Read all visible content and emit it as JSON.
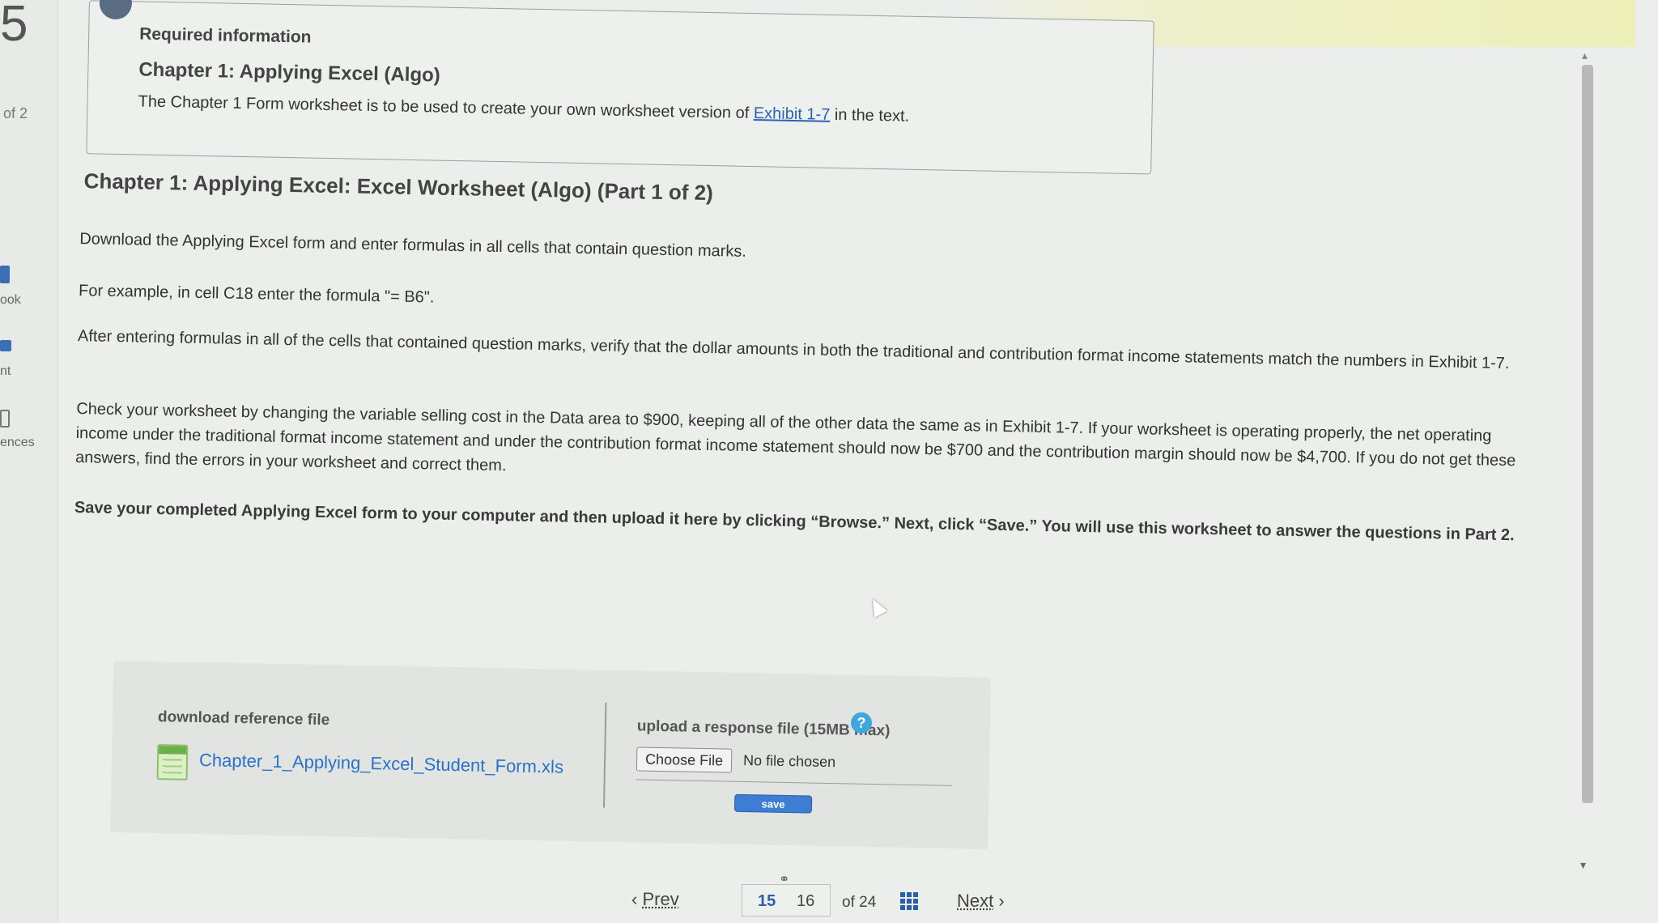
{
  "rail": {
    "question_number": "5",
    "part_of": "of 2",
    "labels": [
      "ook",
      "nt",
      "ences"
    ]
  },
  "info": {
    "header": "Required information",
    "title": "Chapter 1: Applying Excel (Algo)",
    "text_before": "The Chapter 1 Form worksheet is to be used to create your own worksheet version of ",
    "link": "Exhibit 1-7",
    "text_after": " in the text."
  },
  "main": {
    "title": "Chapter 1: Applying Excel: Excel Worksheet (Algo) (Part 1 of 2)",
    "p1": "Download the Applying Excel form and enter formulas in all cells that contain question marks.",
    "p2": "For example, in cell C18 enter the formula \"= B6\".",
    "p3": "After entering formulas in all of the cells that contained question marks, verify that the dollar amounts in both the traditional and contribution format income statements match the numbers in Exhibit 1-7.",
    "p4": "Check your worksheet by changing the variable selling cost in the Data area to $900, keeping all of the other data the same as in Exhibit 1-7. If your worksheet is operating properly, the net operating income under the traditional format income statement and under the contribution format income statement should now be $700 and the contribution margin should now be $4,700. If you do not get these answers, find the errors in your worksheet and correct them.",
    "p5": "Save your completed Applying Excel form to your computer and then upload it here by clicking “Browse.” Next, click “Save.” You will use this worksheet to answer the questions in Part 2."
  },
  "files": {
    "download_label": "download reference file",
    "file_icon": "excel-file-icon",
    "file_name": "Chapter_1_Applying_Excel_Student_Form.xls",
    "upload_label": "upload a response file (15MB max)",
    "help": "?",
    "choose_file": "Choose File",
    "no_file": "No file chosen",
    "save": "save"
  },
  "pager": {
    "prev": "Prev",
    "current": "15",
    "next_page": "16",
    "total": "of 24",
    "next": "Next"
  }
}
